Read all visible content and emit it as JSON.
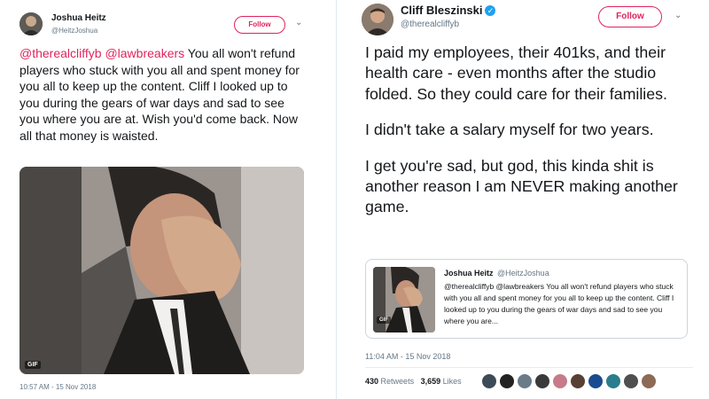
{
  "left_tweet": {
    "name": "Joshua Heitz",
    "handle": "@HeitzJoshua",
    "follow_label": "Follow",
    "mention_1": "@therealcliffyb",
    "mention_2": "@lawbreakers",
    "body": " You all won't refund players who stuck with you all and spent money for you all to keep up the content. Cliff I looked up to you during the gears of war days and sad to see you where you are at. Wish you'd come back. Now all that money is waisted.",
    "gif_badge": "GIF",
    "timestamp": "10:57 AM - 15 Nov 2018"
  },
  "right_tweet": {
    "name": "Cliff Bleszinski",
    "verified_glyph": "✓",
    "handle": "@therealcliffyb",
    "follow_label": "Follow",
    "paragraphs": [
      "I paid my employees, their 401ks, and their health care - even months after the studio folded. So they could care for their families.",
      "I didn't take a salary myself for two years.",
      "I get you're sad, but god, this kinda shit is another reason I am NEVER making another game."
    ],
    "quote": {
      "name": "Joshua Heitz",
      "handle": "@HeitzJoshua",
      "text": "@therealcliffyb @lawbreakers You all won't refund players who stuck with you all and spent money for you all to keep up the content. Cliff I looked up to you during the gears of war days and sad to see you where you are...",
      "gif_badge": "GIF"
    },
    "timestamp": "11:04 AM - 15 Nov 2018",
    "retweets_count": "430",
    "retweets_label": "Retweets",
    "likes_count": "3,659",
    "likes_label": "Likes"
  },
  "colors": {
    "accent": "#e0245e",
    "verified": "#1da1f2",
    "muted": "#657786",
    "border": "#ccd6dd"
  }
}
